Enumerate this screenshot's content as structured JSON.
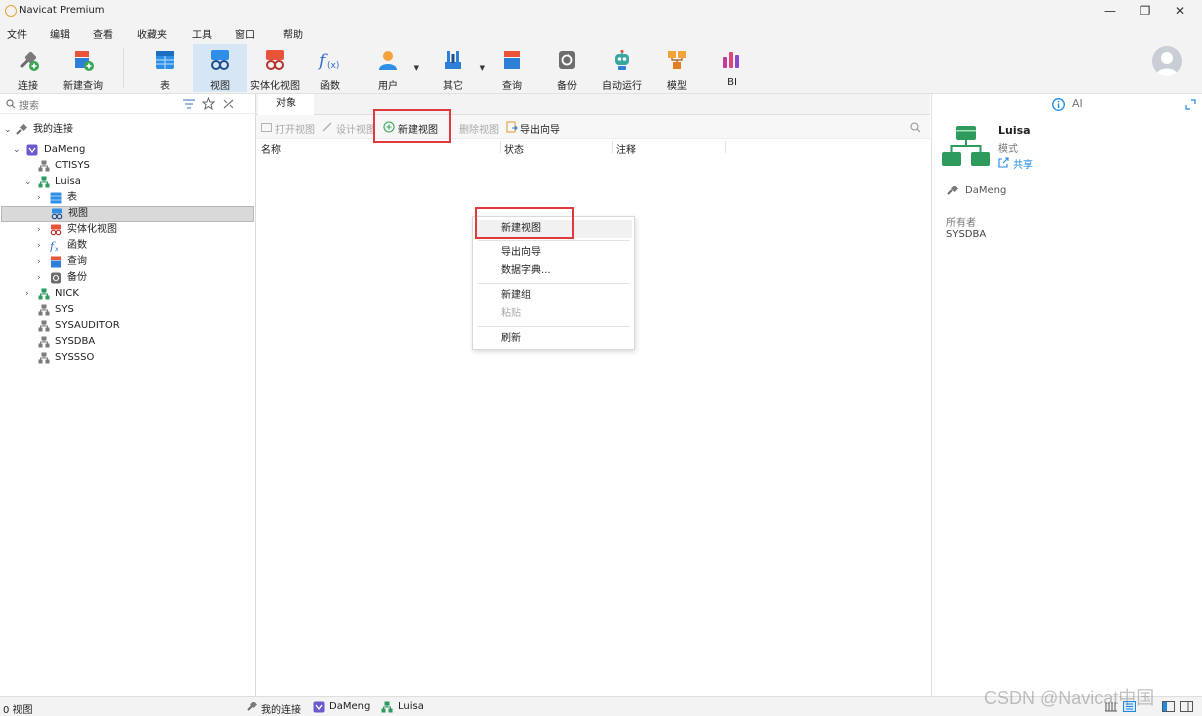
{
  "window": {
    "title": "Navicat Premium",
    "controls": [
      "—",
      "❐",
      "✕"
    ]
  },
  "menu": [
    "文件",
    "编辑",
    "查看",
    "收藏夹",
    "工具",
    "窗口",
    "帮助"
  ],
  "toolbar": {
    "connect": "连接",
    "new_query": "新建查询",
    "table": "表",
    "view": "视图",
    "materialized_view": "实体化视图",
    "function": "函数",
    "user": "用户",
    "others": "其它",
    "query": "查询",
    "backup": "备份",
    "automation": "自动运行",
    "model": "模型",
    "bi": "BI"
  },
  "sidebar": {
    "search_placeholder": "搜索",
    "tree": {
      "root": "我的连接",
      "connection": "DaMeng",
      "schemas": [
        "CTISYS",
        "Luisa",
        "NICK",
        "SYS",
        "SYSAUDITOR",
        "SYSDBA",
        "SYSSSO"
      ],
      "luisa_children": [
        "表",
        "视图",
        "实体化视图",
        "函数",
        "查询",
        "备份"
      ]
    }
  },
  "main": {
    "tab": "对象",
    "object_toolbar": {
      "open_view": "打开视图",
      "design_view": "设计视图",
      "new_view": "新建视图",
      "delete_view": "删除视图",
      "export_wizard": "导出向导"
    },
    "columns": [
      "名称",
      "状态",
      "注释"
    ]
  },
  "context_menu": {
    "items": [
      "新建视图",
      "导出向导",
      "数据字典...",
      "新建组",
      "粘贴",
      "刷新"
    ]
  },
  "info_pane": {
    "ai_label": "AI",
    "name": "Luisa",
    "type": "模式",
    "share": "共享",
    "connection": "DaMeng",
    "owner_label": "所有者",
    "owner_value": "SYSDBA"
  },
  "statusbar": {
    "count": "0 视图",
    "path": [
      "我的连接",
      "DaMeng",
      "Luisa"
    ]
  },
  "watermark": "CSDN @Navicat中国",
  "colors": {
    "accent_blue": "#1e88e5",
    "highlight_red": "#e0393e",
    "selected_bg": "#d9d9d9",
    "toolbar_active": "#d6e6f5"
  }
}
